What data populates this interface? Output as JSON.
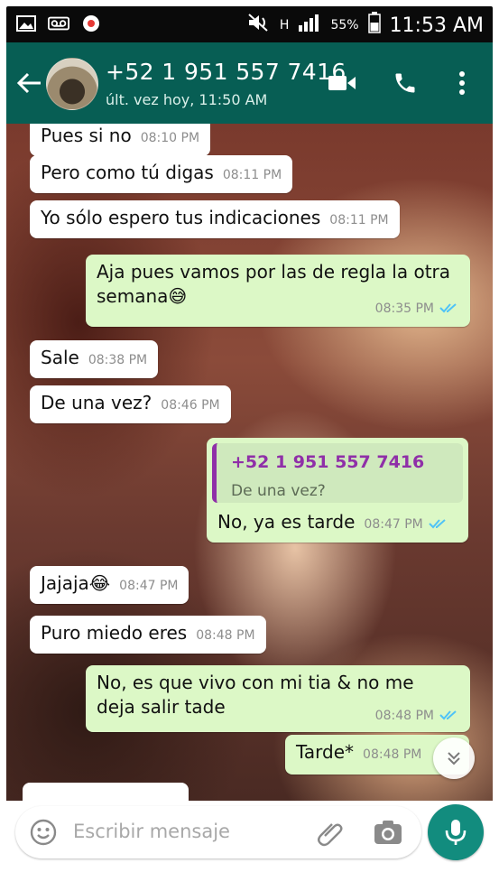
{
  "status_bar": {
    "left_icons": [
      "image-icon",
      "voicemail-icon",
      "notification-icon"
    ],
    "network": "H",
    "battery": "55%",
    "time": "11:53 AM"
  },
  "header": {
    "contact_number": "+52 1 951 557 7416",
    "last_seen": "últ. vez hoy, 11:50 AM"
  },
  "messages": [
    {
      "text": "Pues si no",
      "time": "08:10 PM"
    },
    {
      "text": "Pero como tú digas",
      "time": "08:11 PM"
    },
    {
      "text": "Yo sólo espero tus indicaciones",
      "time": "08:11 PM"
    },
    {
      "line1": "Aja pues vamos por las de regla la otra",
      "line2": "semana😅",
      "time": "08:35 PM"
    },
    {
      "text": "Sale",
      "time": "08:38 PM"
    },
    {
      "text": "De una vez?",
      "time": "08:46 PM"
    },
    {
      "quote_name": "+52 1 951 557 7416",
      "quote_text": "De una vez?",
      "text": "No, ya es tarde",
      "time": "08:47 PM"
    },
    {
      "text": "Jajaja😂",
      "time": "08:47 PM"
    },
    {
      "text": "Puro miedo eres",
      "time": "08:48 PM"
    },
    {
      "line1": "No, es que vivo con mi tia & no me",
      "line2": "deja salir tade",
      "time": "08:48 PM"
    },
    {
      "text": "Tarde*",
      "time": "08:48 PM"
    }
  ],
  "composer": {
    "placeholder": "Escribir mensaje"
  },
  "colors": {
    "header": "#075E54",
    "outgoing_bubble": "#dcf8c6",
    "incoming_bubble": "#ffffff",
    "read_ticks": "#4fc3f7",
    "mic_button": "#128C7E",
    "quote_accent": "#8f2fa8"
  }
}
